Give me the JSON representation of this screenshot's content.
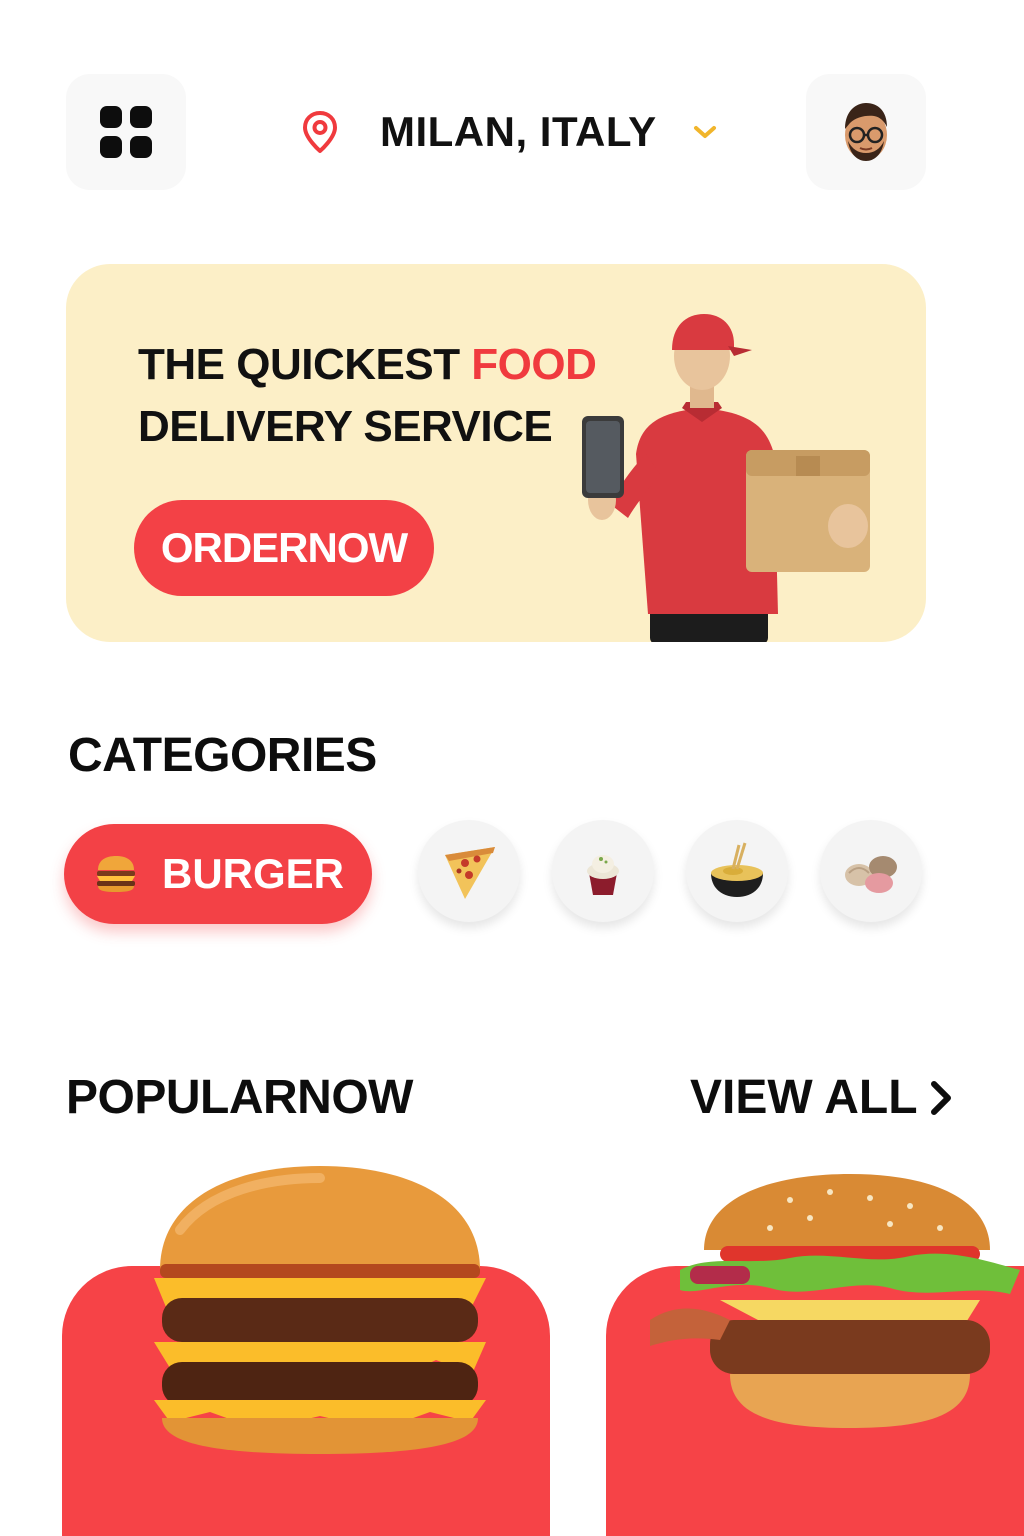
{
  "header": {
    "location": "MILAN, ITALY",
    "menu_icon": "grid-menu-icon",
    "location_icon": "location-pin-icon",
    "dropdown_icon": "chevron-down-icon",
    "avatar_icon": "user-avatar-icon"
  },
  "hero": {
    "title_part1": "THE QUICKEST ",
    "title_accent": "FOOD",
    "title_part2": "DELIVERY SERVICE",
    "button_label": "ORDERNOW",
    "illustration": "delivery-courier-illustration"
  },
  "categories": {
    "title": "CATEGORIES",
    "active": {
      "label": "BURGER",
      "icon": "burger-icon"
    },
    "others": [
      {
        "icon": "pizza-icon"
      },
      {
        "icon": "cupcake-icon"
      },
      {
        "icon": "noodle-bowl-icon"
      },
      {
        "icon": "dumpling-icon"
      }
    ]
  },
  "popular": {
    "title": "POPULARNOW",
    "view_all": "VIEW ALL",
    "view_all_icon": "chevron-right-icon",
    "items": [
      {
        "image": "double-cheeseburger-image"
      },
      {
        "image": "classic-burger-image"
      }
    ]
  },
  "colors": {
    "accent": "#f34146",
    "banner": "#fcefc7",
    "text": "#111111",
    "tile": "#f8f8f8",
    "chevron": "#f1b52b"
  }
}
